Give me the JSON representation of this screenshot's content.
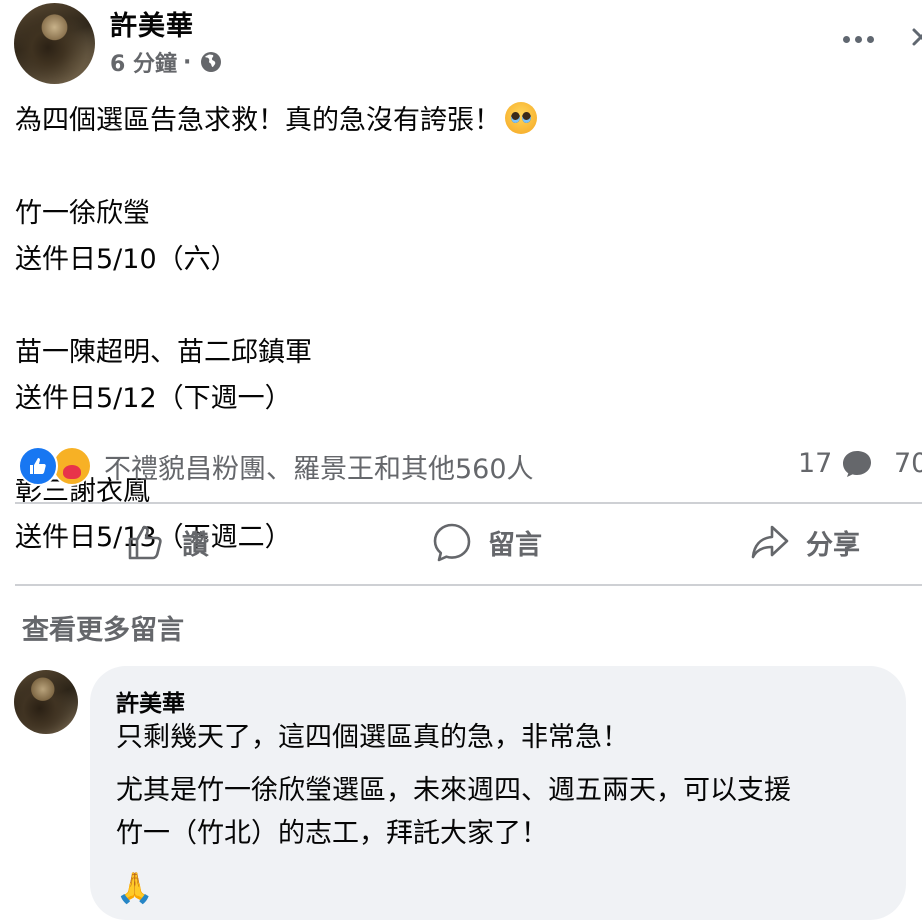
{
  "post": {
    "author": "許美華",
    "time": "6 分鐘",
    "time_separator": "·",
    "audience_icon": "globe-icon",
    "lines": [
      "為四個選區告急求救！真的急沒有誇張！",
      "竹一徐欣瑩",
      "送件日5/10（六）",
      "苗一陳超明、苗二邱鎮軍",
      "送件日5/12（下週一）",
      "彰三謝衣鳳",
      "送件日5/13（下週二）"
    ]
  },
  "reactions": {
    "icons": [
      "like-icon",
      "care-icon"
    ],
    "summary": "不禮貌昌粉團、羅景王和其他560人",
    "comments": "17",
    "shares": "70"
  },
  "actions": {
    "like": "讚",
    "comment": "留言",
    "share": "分享"
  },
  "view_more_comments": "查看更多留言",
  "comment": {
    "author": "許美華",
    "lines": [
      "只剩幾天了，這四個選區真的急，非常急！",
      "尤其是竹一徐欣瑩選區，未來週四、週五兩天，可以支援",
      "竹一（竹北）的志工，拜託大家了！"
    ],
    "emoji": "🙏"
  },
  "colors": {
    "secondary_text": "#65676b",
    "like_blue": "#1877f2",
    "comment_bg": "#f0f2f5",
    "divider": "#ced0d4"
  }
}
